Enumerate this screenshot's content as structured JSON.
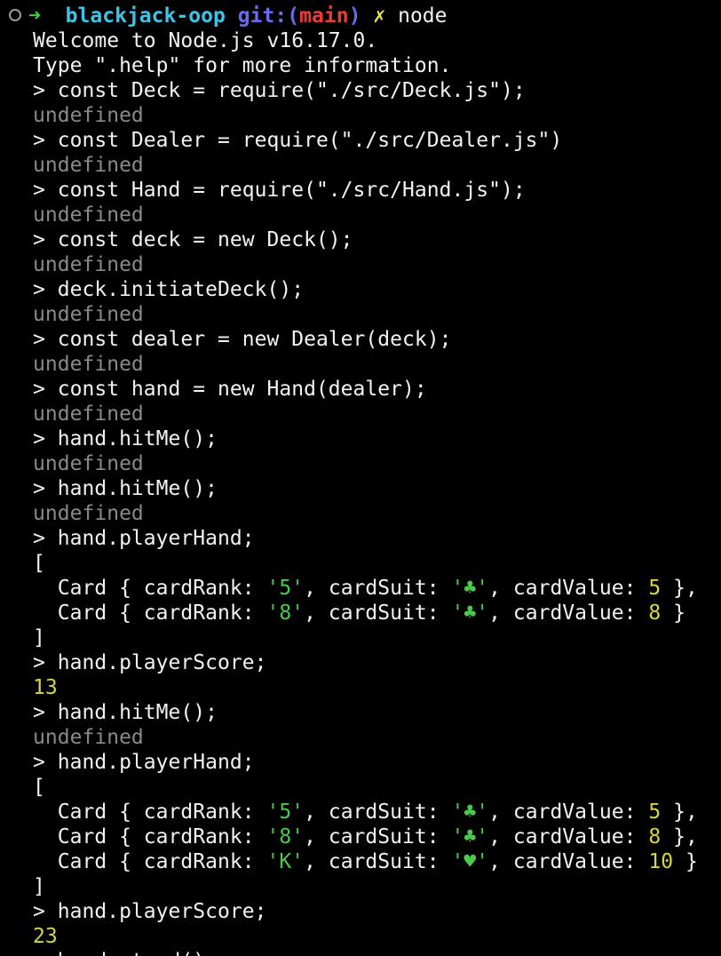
{
  "prompt": {
    "arrow": "➜",
    "dir": "blackjack-oop",
    "git_label": "git:(",
    "branch": "main",
    "git_close": ")",
    "dirty_mark": "✗",
    "command": "node"
  },
  "welcome": [
    "Welcome to Node.js v16.17.0.",
    "Type \".help\" for more information."
  ],
  "undef": "undefined",
  "repl": {
    "cmd1": "> const Deck = require(\"./src/Deck.js\");",
    "cmd2": "> const Dealer = require(\"./src/Dealer.js\")",
    "cmd3": "> const Hand = require(\"./src/Hand.js\");",
    "cmd4": "> const deck = new Deck();",
    "cmd5": "> deck.initiateDeck();",
    "cmd6": "> const dealer = new Dealer(deck);",
    "cmd7": "> const hand = new Hand(dealer);",
    "cmd8": "> hand.hitMe();",
    "cmd9": "> hand.hitMe();",
    "cmd10": "> hand.playerHand;",
    "cmd11": "> hand.playerScore;",
    "cmd12": "> hand.hitMe();",
    "cmd13": "> hand.playerHand;",
    "cmd14": "> hand.playerScore;",
    "cmd15_partial": "> hand.stand();"
  },
  "brackets": {
    "open": "[",
    "close": "]"
  },
  "labels": {
    "card_open": "  Card { cardRank: ",
    "suit_key": ", cardSuit: ",
    "value_key": ", cardValue: ",
    "end_comma": " },",
    "end": " }"
  },
  "hand1": [
    {
      "rank": "'5'",
      "suit": "'♣'",
      "value": "5"
    },
    {
      "rank": "'8'",
      "suit": "'♣'",
      "value": "8"
    }
  ],
  "score1": "13",
  "hand2": [
    {
      "rank": "'5'",
      "suit": "'♣'",
      "value": "5"
    },
    {
      "rank": "'8'",
      "suit": "'♣'",
      "value": "8"
    },
    {
      "rank": "'K'",
      "suit": "'♥'",
      "value": "10"
    }
  ],
  "score2": "23",
  "colors": {
    "background": "#000000",
    "foreground": "#f2f2f2",
    "prompt_arrow": "#3fd23f",
    "directory": "#3cc5e8",
    "git": "#6a6cf0",
    "branch": "#f03a3a",
    "dirty": "#e8e84a",
    "undefined": "#8a8a8a",
    "string": "#4ac94a",
    "number": "#d6d63a"
  }
}
